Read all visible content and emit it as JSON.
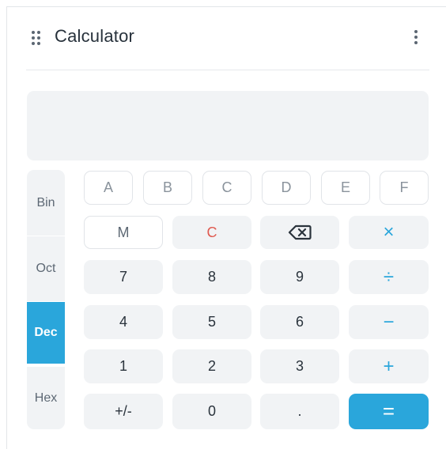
{
  "app": {
    "title": "Calculator"
  },
  "display": {
    "value": ""
  },
  "bases": [
    {
      "label": "Bin",
      "active": false
    },
    {
      "label": "Oct",
      "active": false
    },
    {
      "label": "Dec",
      "active": true
    },
    {
      "label": "Hex",
      "active": false
    }
  ],
  "hex_keys": [
    "A",
    "B",
    "C",
    "D",
    "E",
    "F"
  ],
  "keys": {
    "memory": "M",
    "clear": "C",
    "backspace_icon": "backspace-icon",
    "multiply": "×",
    "divide": "÷",
    "subtract": "−",
    "add": "+",
    "equals": "=",
    "sign": "+/-",
    "decimal": ".",
    "digits": [
      "0",
      "1",
      "2",
      "3",
      "4",
      "5",
      "6",
      "7",
      "8",
      "9"
    ]
  },
  "colors": {
    "accent": "#2aa6db",
    "clear": "#e05a50",
    "key_bg": "#f1f3f5"
  }
}
